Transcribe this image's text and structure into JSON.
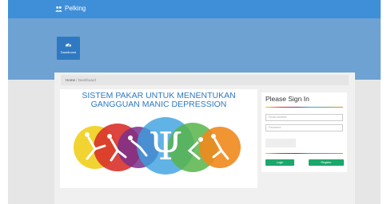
{
  "navbar": {
    "brand": "Pelking",
    "icon": "users-icon"
  },
  "dashboard_tile": {
    "label": "Dashboard",
    "icon": "tachometer-icon"
  },
  "breadcrumb": {
    "home": "Home",
    "separator": "/",
    "current": "Dashboard"
  },
  "main": {
    "title": "SISTEM PAKAR UNTUK MENENTUKAN GANGGUAN MANIC DEPRESSION",
    "logo": {
      "icon": "psi-symbol-icon",
      "symbol": "Ψ"
    }
  },
  "signin": {
    "title": "Please Sign In",
    "email_placeholder": "Email Address",
    "password_placeholder": "Password",
    "login_label": "Login",
    "register_label": "Register"
  },
  "colors": {
    "navbar": "#3f8fd8",
    "hero": "#6ea2d3",
    "tile": "#2f79c2",
    "title": "#2f79c2",
    "button": "#1aa86b",
    "circles": [
      "#f0d020",
      "#d9312b",
      "#7a2f8c",
      "#3aa0e0",
      "#58b44a",
      "#f08a1c"
    ]
  }
}
